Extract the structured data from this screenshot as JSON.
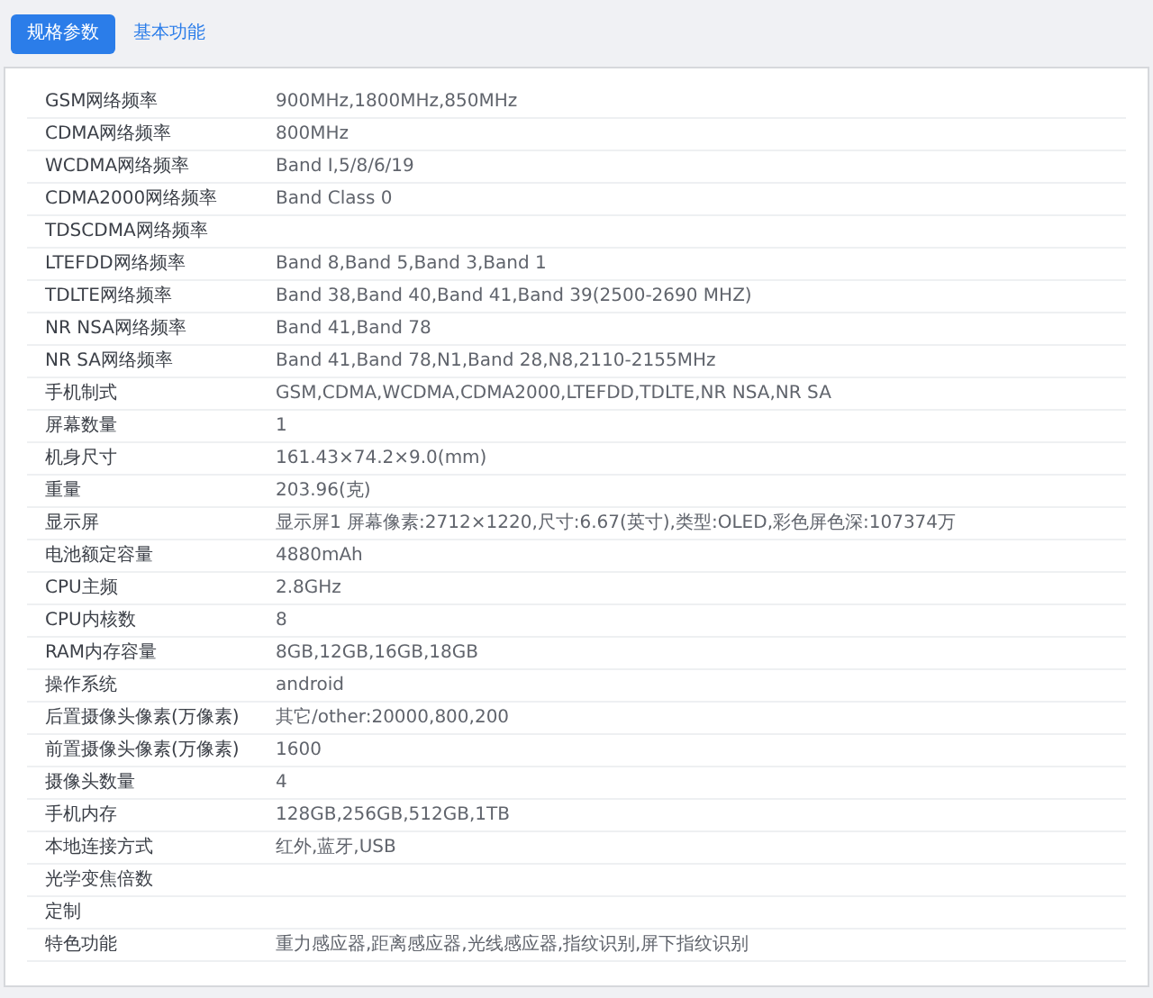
{
  "tabs": [
    {
      "label": "规格参数",
      "selected": true
    },
    {
      "label": "基本功能",
      "selected": false
    }
  ],
  "specs": [
    {
      "label": "GSM网络频率",
      "value": "900MHz,1800MHz,850MHz"
    },
    {
      "label": "CDMA网络频率",
      "value": "800MHz"
    },
    {
      "label": "WCDMA网络频率",
      "value": "Band I,5/8/6/19"
    },
    {
      "label": "CDMA2000网络频率",
      "value": "Band Class 0"
    },
    {
      "label": "TDSCDMA网络频率"
    },
    {
      "label": "LTEFDD网络频率",
      "value": "Band 8,Band 5,Band 3,Band 1"
    },
    {
      "label": "TDLTE网络频率",
      "value": "Band 38,Band 40,Band 41,Band 39(2500-2690 MHZ)"
    },
    {
      "label": "NR NSA网络频率",
      "value": "Band 41,Band 78"
    },
    {
      "label": "NR SA网络频率",
      "value": "Band 41,Band 78,N1,Band 28,N8,2110-2155MHz"
    },
    {
      "label": "手机制式",
      "value": "GSM,CDMA,WCDMA,CDMA2000,LTEFDD,TDLTE,NR NSA,NR SA"
    },
    {
      "label": "屏幕数量",
      "value": "1"
    },
    {
      "label": "机身尺寸",
      "value": "161.43×74.2×9.0(mm)"
    },
    {
      "label": "重量",
      "value": "203.96(克)"
    },
    {
      "label": "显示屏",
      "value": "显示屏1 屏幕像素:2712×1220,尺寸:6.67(英寸),类型:OLED,彩色屏色深:107374万"
    },
    {
      "label": "电池额定容量",
      "value": "4880mAh"
    },
    {
      "label": "CPU主频",
      "value": "2.8GHz"
    },
    {
      "label": "CPU内核数",
      "value": "8"
    },
    {
      "label": "RAM内存容量",
      "value": "8GB,12GB,16GB,18GB"
    },
    {
      "label": "操作系统",
      "value": "android"
    },
    {
      "label": "后置摄像头像素(万像素)",
      "value": "其它/other:20000,800,200"
    },
    {
      "label": "前置摄像头像素(万像素)",
      "value": "1600"
    },
    {
      "label": "摄像头数量",
      "value": "4"
    },
    {
      "label": "手机内存",
      "value": "128GB,256GB,512GB,1TB"
    },
    {
      "label": "本地连接方式",
      "value": "红外,蓝牙,USB"
    },
    {
      "label": "光学变焦倍数"
    },
    {
      "label": "定制"
    },
    {
      "label": "特色功能",
      "value": "重力感应器,距离感应器,光线感应器,指纹识别,屏下指纹识别"
    }
  ]
}
